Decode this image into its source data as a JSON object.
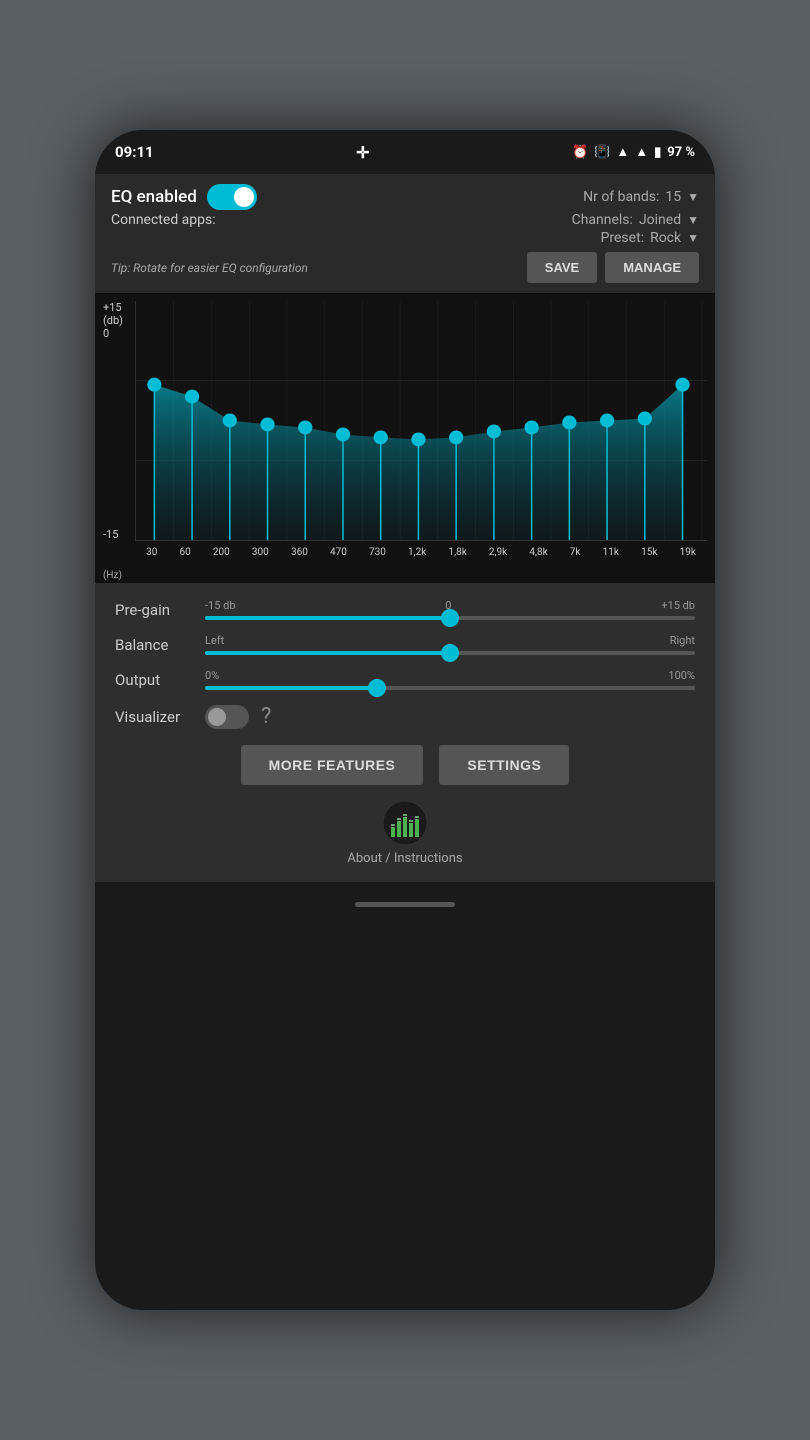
{
  "statusBar": {
    "time": "09:11",
    "battery": "97 %",
    "icons": [
      "alarm-icon",
      "vibrate-icon",
      "wifi-icon",
      "signal-icon",
      "battery-icon"
    ]
  },
  "header": {
    "eqEnabledLabel": "EQ enabled",
    "eqEnabled": true,
    "nrBandsLabel": "Nr of bands:",
    "nrBandsValue": "15",
    "connectedAppsLabel": "Connected apps:",
    "channelsLabel": "Channels:",
    "channelsValue": "Joined",
    "presetLabel": "Preset:",
    "presetValue": "Rock",
    "tipText": "Tip: Rotate for easier EQ configuration",
    "saveLabel": "SAVE",
    "manageLabel": "MANAGE"
  },
  "eqChart": {
    "yLabels": [
      "+15",
      "(db)",
      "0",
      "-15"
    ],
    "xLabels": [
      "30",
      "60",
      "200",
      "300",
      "360",
      "470",
      "730",
      "1,2k",
      "1,8k",
      "2,9k",
      "4,8k",
      "7k",
      "11k",
      "15k",
      "19k"
    ],
    "xSubLabel": "(Hz)",
    "bands": [
      {
        "freq": "30",
        "gainPct": 0.65
      },
      {
        "freq": "60",
        "gainPct": 0.6
      },
      {
        "freq": "200",
        "gainPct": 0.5
      },
      {
        "freq": "300",
        "gainPct": 0.48
      },
      {
        "freq": "360",
        "gainPct": 0.47
      },
      {
        "freq": "470",
        "gainPct": 0.44
      },
      {
        "freq": "730",
        "gainPct": 0.43
      },
      {
        "freq": "1,2k",
        "gainPct": 0.42
      },
      {
        "freq": "1,8k",
        "gainPct": 0.43
      },
      {
        "freq": "2,9k",
        "gainPct": 0.45
      },
      {
        "freq": "4,8k",
        "gainPct": 0.47
      },
      {
        "freq": "7k",
        "gainPct": 0.49
      },
      {
        "freq": "11k",
        "gainPct": 0.5
      },
      {
        "freq": "15k",
        "gainPct": 0.51
      },
      {
        "freq": "19k",
        "gainPct": 0.65
      }
    ]
  },
  "controls": {
    "pregain": {
      "label": "Pre-gain",
      "minLabel": "-15 db",
      "midLabel": "0",
      "maxLabel": "+15 db",
      "valuePct": 50
    },
    "balance": {
      "label": "Balance",
      "minLabel": "Left",
      "maxLabel": "Right",
      "valuePct": 50
    },
    "output": {
      "label": "Output",
      "minLabel": "0%",
      "maxLabel": "100%",
      "valuePct": 35
    },
    "visualizer": {
      "label": "Visualizer",
      "enabled": false
    }
  },
  "bottomButtons": {
    "moreFeaturesLabel": "MORE FEATURES",
    "settingsLabel": "SETTINGS"
  },
  "about": {
    "label": "About / Instructions"
  }
}
